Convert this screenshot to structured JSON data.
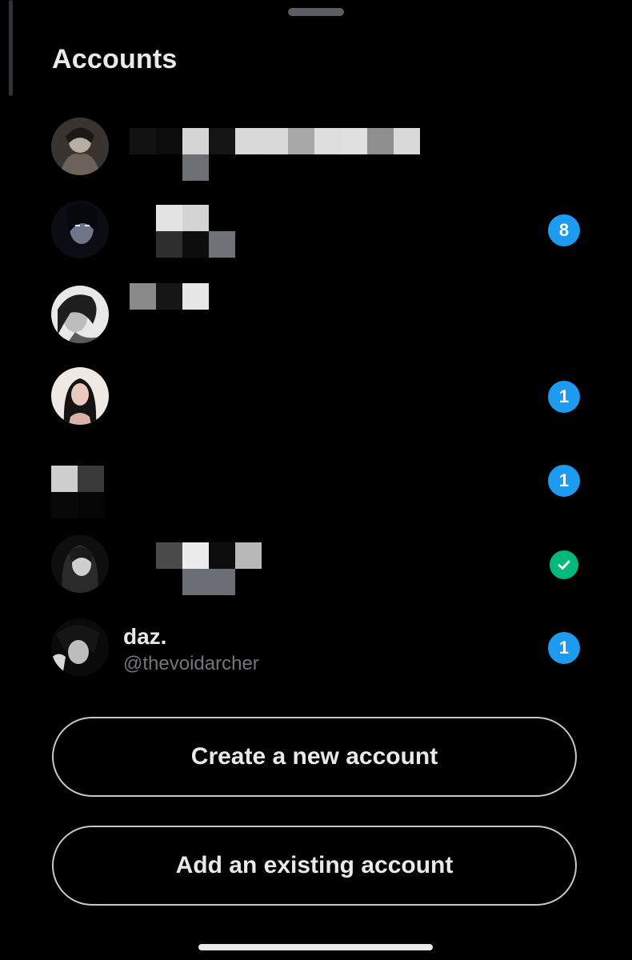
{
  "sheet": {
    "title": "Accounts"
  },
  "accounts": [
    {
      "badge": ""
    },
    {
      "badge": "8"
    },
    {
      "badge": ""
    },
    {
      "badge": "1"
    },
    {
      "badge": "1"
    },
    {
      "badge": "check",
      "status": "current-account"
    },
    {
      "name": "daz.",
      "handle": "@thevoidarcher",
      "badge": "1"
    }
  ],
  "buttons": {
    "create": "Create a new account",
    "add_existing": "Add an existing account"
  },
  "colors": {
    "background": "#000000",
    "badge_blue": "#1d9bf0",
    "check_green": "#00ba7c",
    "handle_gray": "#71767b"
  }
}
